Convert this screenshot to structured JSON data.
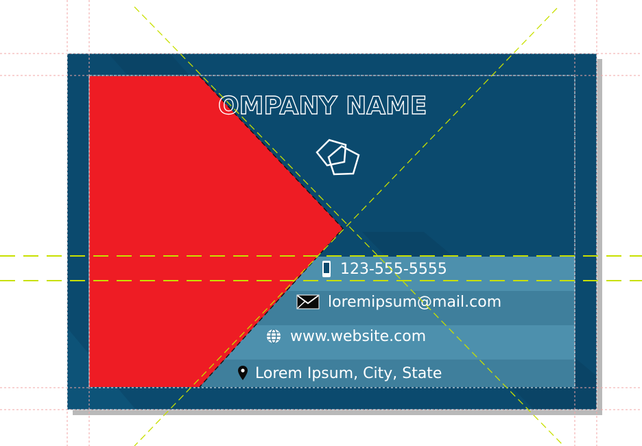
{
  "card": {
    "company_name": "OMPANY NAME",
    "logo_icon": "pentagon-logo-icon",
    "contacts": [
      {
        "icon": "mobile-phone-icon",
        "text": "123-555-5555"
      },
      {
        "icon": "envelope-icon",
        "text": "loremipsum@mail.com"
      },
      {
        "icon": "globe-icon",
        "text": "www.website.com"
      },
      {
        "icon": "map-pin-icon",
        "text": "Lorem Ipsum, City, State"
      }
    ]
  },
  "colors": {
    "card_background": "#0b4a6e",
    "card_dark_stripe": "#093d5c",
    "info_band_light": "#4d90ad",
    "info_band_dark": "#3f7f9c",
    "red_shape": "#ee1c24",
    "guide_green": "#c8e000",
    "guide_pink": "#f2a5a5"
  }
}
